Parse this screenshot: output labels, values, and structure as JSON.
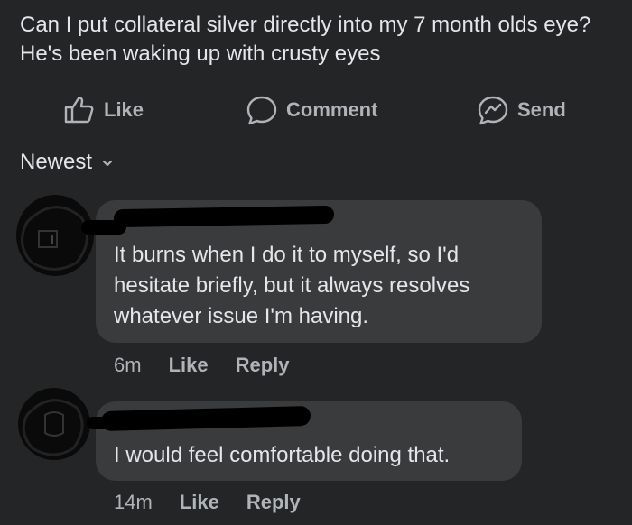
{
  "post": {
    "text": "Can I put collateral silver directly into my 7 month olds eye? He's been waking up with crusty eyes"
  },
  "actions": {
    "like_label": "Like",
    "comment_label": "Comment",
    "send_label": "Send"
  },
  "sort": {
    "label": "Newest"
  },
  "comments": [
    {
      "text": "It burns when I do it to myself, so I'd hesitate briefly, but it always resolves whatever issue I'm having.",
      "time": "6m",
      "like_label": "Like",
      "reply_label": "Reply"
    },
    {
      "text": "I would feel comfortable doing that.",
      "time": "14m",
      "like_label": "Like",
      "reply_label": "Reply"
    }
  ],
  "colors": {
    "background": "#242526",
    "bubble": "#3a3b3c",
    "text_primary": "#e4e6eb",
    "text_secondary": "#b0b3b8"
  }
}
